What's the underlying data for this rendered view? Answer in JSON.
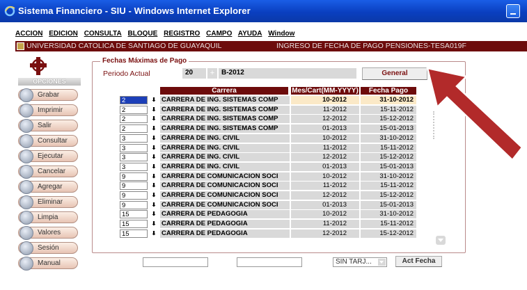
{
  "window": {
    "title": "Sistema Financiero - SIU - Windows Internet Explorer"
  },
  "menu": [
    "ACCION",
    "EDICION",
    "CONSULTA",
    "BLOQUE",
    "REGISTRO",
    "CAMPO",
    "AYUDA",
    "Window"
  ],
  "infobar": {
    "university": "UNIVERSIDAD CATOLICA DE SANTIAGO DE GUAYAQUIL",
    "module": "INGRESO DE FECHA DE PAGO PENSIONES-TESA019F"
  },
  "sidebar": {
    "heading": "OPCIONES",
    "buttons": [
      "Grabar",
      "Imprimir",
      "Salir",
      "Consultar",
      "Ejecutar",
      "Cancelar",
      "Agregar",
      "Eliminar",
      "Limpia",
      "Valores",
      "Sesión",
      "Manual"
    ]
  },
  "panel": {
    "title": "Fechas Máximas de Pago"
  },
  "periodo": {
    "label": "Periodo Actual",
    "code": "20",
    "plus": "+",
    "value": "B-2012",
    "general_button": "General"
  },
  "grid": {
    "headers": {
      "carrera": "Carrera",
      "mes": "Mes/Cart(MM-YYYY)",
      "fecha": "Fecha Pago"
    },
    "rows": [
      {
        "num": "2",
        "carrera": "CARRERA DE ING. SISTEMAS COMP",
        "mes": "10-2012",
        "fecha": "31-10-2012"
      },
      {
        "num": "2",
        "carrera": "CARRERA DE ING. SISTEMAS COMP",
        "mes": "11-2012",
        "fecha": "15-11-2012"
      },
      {
        "num": "2",
        "carrera": "CARRERA DE ING. SISTEMAS COMP",
        "mes": "12-2012",
        "fecha": "15-12-2012"
      },
      {
        "num": "2",
        "carrera": "CARRERA DE ING. SISTEMAS COMP",
        "mes": "01-2013",
        "fecha": "15-01-2013"
      },
      {
        "num": "3",
        "carrera": "CARRERA DE ING. CIVIL",
        "mes": "10-2012",
        "fecha": "31-10-2012"
      },
      {
        "num": "3",
        "carrera": "CARRERA DE ING. CIVIL",
        "mes": "11-2012",
        "fecha": "15-11-2012"
      },
      {
        "num": "3",
        "carrera": "CARRERA DE ING. CIVIL",
        "mes": "12-2012",
        "fecha": "15-12-2012"
      },
      {
        "num": "3",
        "carrera": "CARRERA DE ING. CIVIL",
        "mes": "01-2013",
        "fecha": "15-01-2013"
      },
      {
        "num": "9",
        "carrera": "CARRERA DE COMUNICACION SOCI",
        "mes": "10-2012",
        "fecha": "31-10-2012"
      },
      {
        "num": "9",
        "carrera": "CARRERA DE COMUNICACION SOCI",
        "mes": "11-2012",
        "fecha": "15-11-2012"
      },
      {
        "num": "9",
        "carrera": "CARRERA DE COMUNICACION SOCI",
        "mes": "12-2012",
        "fecha": "15-12-2012"
      },
      {
        "num": "9",
        "carrera": "CARRERA DE COMUNICACION SOCI",
        "mes": "01-2013",
        "fecha": "15-01-2013"
      },
      {
        "num": "15",
        "carrera": "CARRERA DE PEDAGOGIA",
        "mes": "10-2012",
        "fecha": "31-10-2012"
      },
      {
        "num": "15",
        "carrera": "CARRERA DE PEDAGOGIA",
        "mes": "11-2012",
        "fecha": "15-11-2012"
      },
      {
        "num": "15",
        "carrera": "CARRERA DE PEDAGOGIA",
        "mes": "12-2012",
        "fecha": "15-12-2012"
      }
    ]
  },
  "footer": {
    "tarjeta_select": "SIN TARJ...",
    "act_fecha_button": "Act Fecha"
  },
  "colors": {
    "titlebar": "#0a3fc0",
    "brand_maroon": "#6d0c0c",
    "selected_row": "#1c3fb8",
    "annotation_arrow": "#b22a2a"
  },
  "icons": [
    "ie-icon",
    "minimize-icon",
    "university-crest-icon",
    "cross-logo-icon",
    "dropdown-arrow-icon"
  ]
}
